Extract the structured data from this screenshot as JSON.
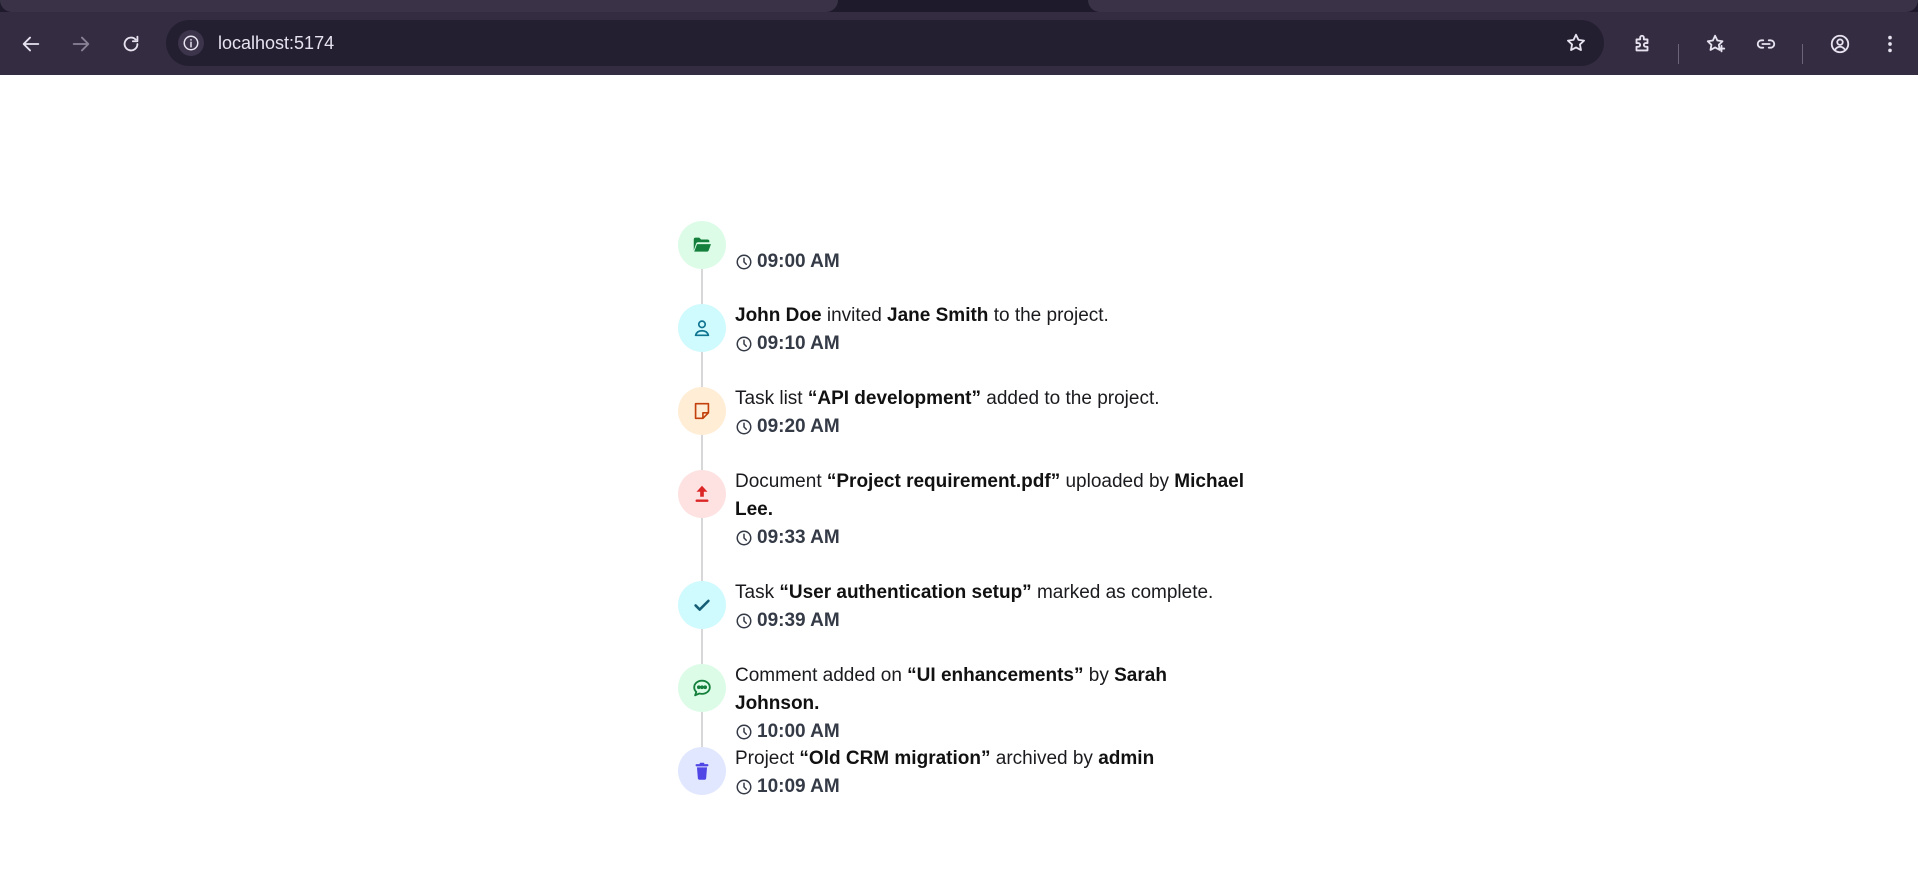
{
  "browser": {
    "url": "localhost:5174",
    "colors": {
      "chrome_bg": "#342d42",
      "omnibox_bg": "#241f30",
      "icon": "#e7e2f0"
    }
  },
  "timeline": {
    "items": [
      {
        "icon": "folder-open-icon",
        "icon_bg": "#dcfce7",
        "icon_color": "#15803d",
        "text": [],
        "time": "09:00 AM"
      },
      {
        "icon": "user-icon",
        "icon_bg": "#cffafe",
        "icon_color": "#0e7490",
        "text": [
          {
            "t": "John Doe",
            "b": true
          },
          {
            "t": " invited ",
            "b": false
          },
          {
            "t": "Jane Smith",
            "b": true
          },
          {
            "t": " to the project.",
            "b": false
          }
        ],
        "time": "09:10 AM"
      },
      {
        "icon": "sticky-note-icon",
        "icon_bg": "#ffedd5",
        "icon_color": "#c2410c",
        "text": [
          {
            "t": "Task list ",
            "b": false
          },
          {
            "t": "“API development”",
            "b": true
          },
          {
            "t": " added to the project.",
            "b": false
          }
        ],
        "time": "09:20 AM"
      },
      {
        "icon": "upload-icon",
        "icon_bg": "#fee2e2",
        "icon_color": "#dc2626",
        "text": [
          {
            "t": "Document ",
            "b": false
          },
          {
            "t": "“Project requirement.pdf”",
            "b": true
          },
          {
            "t": " uploaded by ",
            "b": false
          },
          {
            "t": "Michael Lee.",
            "b": true
          }
        ],
        "time": "09:33 AM"
      },
      {
        "icon": "check-icon",
        "icon_bg": "#cffafe",
        "icon_color": "#155e75",
        "text": [
          {
            "t": "Task ",
            "b": false
          },
          {
            "t": "“User authentication setup”",
            "b": true
          },
          {
            "t": " marked as complete.",
            "b": false
          }
        ],
        "time": "09:39 AM"
      },
      {
        "icon": "comment-icon",
        "icon_bg": "#dcfce7",
        "icon_color": "#15803d",
        "text": [
          {
            "t": "Comment added on ",
            "b": false
          },
          {
            "t": "“UI enhancements”",
            "b": true
          },
          {
            "t": " by ",
            "b": false
          },
          {
            "t": "Sarah Johnson.",
            "b": true
          }
        ],
        "time": "10:00 AM"
      },
      {
        "icon": "trash-icon",
        "icon_bg": "#e0e7ff",
        "icon_color": "#4f46e5",
        "text": [
          {
            "t": "Project ",
            "b": false
          },
          {
            "t": "“Old CRM migration”",
            "b": true
          },
          {
            "t": " archived by ",
            "b": false
          },
          {
            "t": "admin",
            "b": true
          }
        ],
        "time": "10:09 AM"
      }
    ]
  }
}
